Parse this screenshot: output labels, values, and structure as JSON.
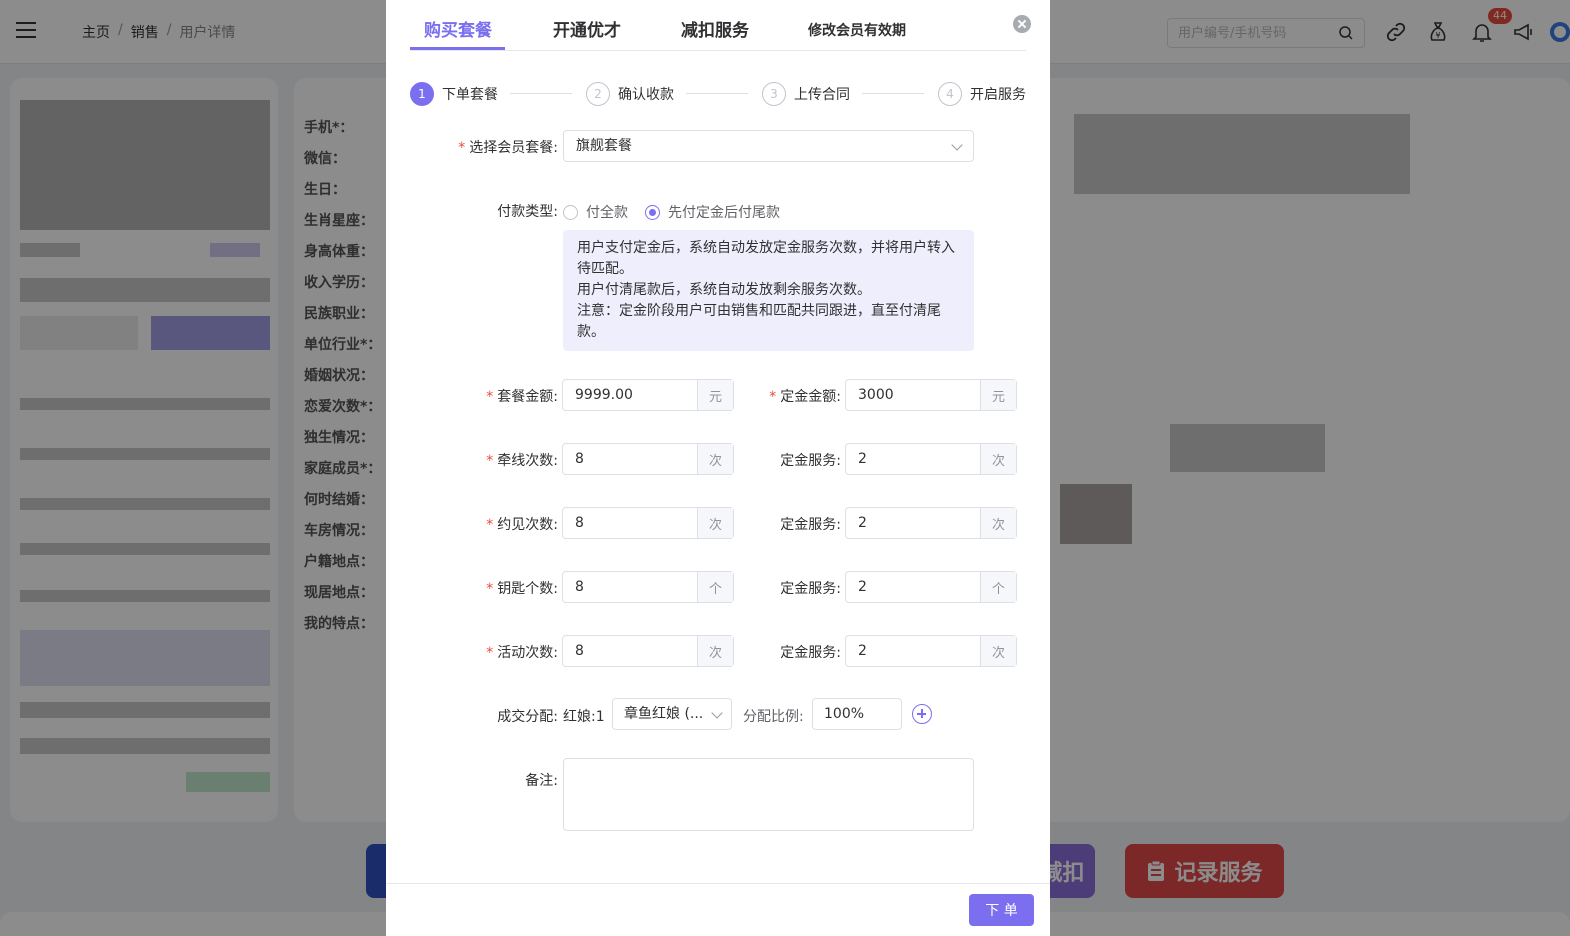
{
  "breadcrumb": {
    "home": "主页",
    "section": "销售",
    "current": "用户详情",
    "separator": "/"
  },
  "search": {
    "placeholder": "用户编号/手机号码"
  },
  "notifications": {
    "count": "44"
  },
  "profile_fields": [
    "手机*：",
    "微信：",
    "生日：",
    "生肖星座：",
    "身高体重：",
    "收入学历：",
    "民族职业：",
    "单位行业*：",
    "婚姻状况：",
    "恋爱次数*：",
    "独生情况：",
    "家庭成员*：",
    "何时结婚：",
    "车房情况：",
    "户籍地点：",
    "现居地点：",
    "我的特点："
  ],
  "bottom_buttons": {
    "deduct": "减扣",
    "record": "记录服务"
  },
  "modal": {
    "tabs": [
      "购买套餐",
      "开通优才",
      "减扣服务",
      "修改会员有效期"
    ],
    "active_tab": 0,
    "steps": [
      {
        "num": "1",
        "label": "下单套餐"
      },
      {
        "num": "2",
        "label": "确认收款"
      },
      {
        "num": "3",
        "label": "上传合同"
      },
      {
        "num": "4",
        "label": "开启服务"
      }
    ],
    "package": {
      "label": "选择会员套餐:",
      "value": "旗舰套餐"
    },
    "payment": {
      "label": "付款类型:",
      "options": [
        "付全款",
        "先付定金后付尾款"
      ],
      "selected": 1
    },
    "notice": {
      "line1": "用户支付定金后，系统自动发放定金服务次数，并将用户转入待匹配。",
      "line2": "用户付清尾款后，系统自动发放剩余服务次数。",
      "line3": "注意：定金阶段用户可由销售和匹配共同跟进，直至付清尾款。"
    },
    "amounts": {
      "package_label": "套餐金额:",
      "package_value": "9999.00",
      "package_unit": "元",
      "deposit_label": "定金金额:",
      "deposit_value": "3000",
      "deposit_unit": "元"
    },
    "services": [
      {
        "label": "牵线次数:",
        "value": "8",
        "unit": "次",
        "dep_label": "定金服务:",
        "dep_value": "2",
        "dep_unit": "次"
      },
      {
        "label": "约见次数:",
        "value": "8",
        "unit": "次",
        "dep_label": "定金服务:",
        "dep_value": "2",
        "dep_unit": "次"
      },
      {
        "label": "钥匙个数:",
        "value": "8",
        "unit": "个",
        "dep_label": "定金服务:",
        "dep_value": "2",
        "dep_unit": "个"
      },
      {
        "label": "活动次数:",
        "value": "8",
        "unit": "次",
        "dep_label": "定金服务:",
        "dep_value": "2",
        "dep_unit": "次"
      }
    ],
    "allocation": {
      "label": "成交分配:",
      "role": "红娘:1",
      "matchmaker": "章鱼红娘 (...",
      "ratio_label": "分配比例:",
      "ratio_value": "100%"
    },
    "remark": {
      "label": "备注:",
      "value": ""
    },
    "submit": "下 单"
  },
  "colors": {
    "accent": "#7b6ff0",
    "required": "#e84c3d",
    "notice_bg": "#efeefd"
  }
}
